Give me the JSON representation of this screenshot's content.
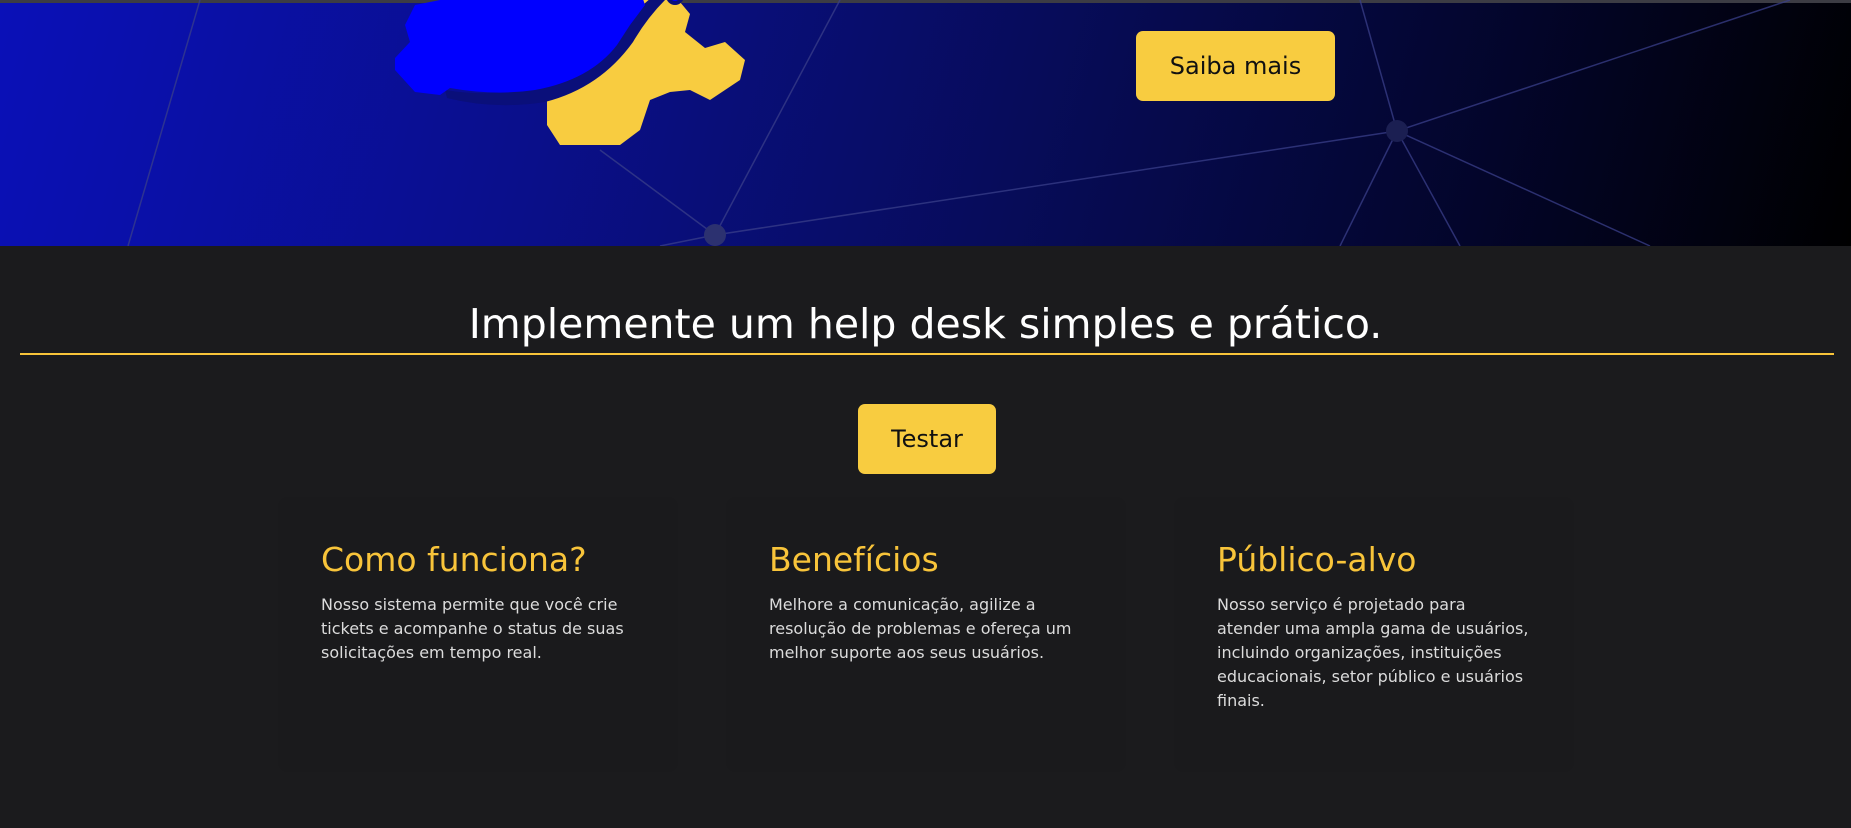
{
  "hero": {
    "cta_label": "Saiba mais"
  },
  "colors": {
    "accent": "#f8cc40",
    "heading_accent": "#f8c43a",
    "background": "#1b1b1d",
    "hero_blue": "#0000ff"
  },
  "intro": {
    "title": "Implemente um help desk simples e prático.",
    "cta_label": "Testar"
  },
  "cards": [
    {
      "title": "Como funciona?",
      "text": "Nosso sistema permite que você crie tickets e acompanhe o status de suas solicitações em tempo real."
    },
    {
      "title": "Benefícios",
      "text": "Melhore a comunicação, agilize a resolução de problemas e ofereça um melhor suporte aos seus usuários."
    },
    {
      "title": "Público-alvo",
      "text": "Nosso serviço é projetado para atender uma ampla gama de usuários, incluindo organizações, instituições educacionais, setor público e usuários finais."
    }
  ],
  "icons": {
    "hero_illustration": "gears-icon"
  }
}
